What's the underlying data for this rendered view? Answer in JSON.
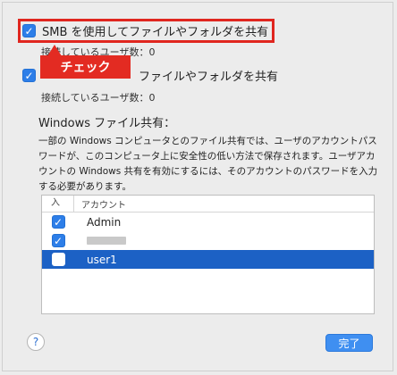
{
  "options": {
    "smb_label": "SMB を使用してファイルやフォルダを共有",
    "smb_connected": "接続しているユーザ数：0",
    "afp_label": "ファイルやフォルダを共有",
    "afp_connected": "接続しているユーザ数：0"
  },
  "annotation": {
    "callout": "チェック"
  },
  "windows_sharing": {
    "title": "Windows ファイル共有：",
    "description": "一部の Windows コンピュータとのファイル共有では、ユーザのアカウントパスワードが、このコンピュータ上に安全性の低い方法で保存されます。ユーザアカウントの Windows 共有を有効にするには、そのアカウントのパスワードを入力する必要があります。"
  },
  "table": {
    "headers": {
      "enabled": "入",
      "account": "アカウント"
    },
    "rows": [
      {
        "checked": true,
        "name": "Admin"
      },
      {
        "checked": true,
        "name": ""
      },
      {
        "checked": false,
        "name": "user1",
        "selected": true
      }
    ]
  },
  "buttons": {
    "help": "?",
    "done": "完了"
  },
  "colors": {
    "accent": "#2d7ee8",
    "selection": "#1c61c5",
    "callout": "#e32b22"
  }
}
